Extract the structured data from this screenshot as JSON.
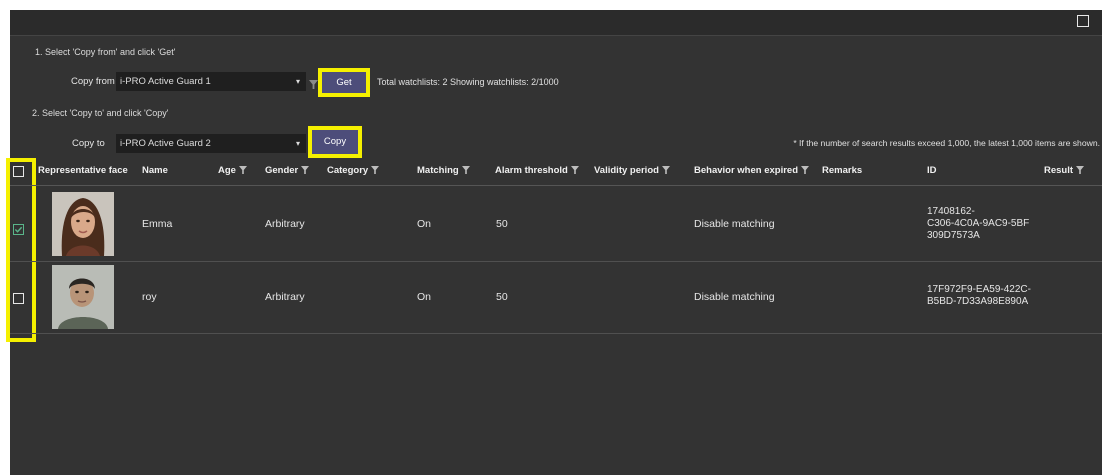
{
  "step1": "1. Select 'Copy from' and click 'Get'",
  "step2": "2. Select 'Copy to' and click 'Copy'",
  "copy_from": {
    "label": "Copy from",
    "value": "i-PRO Active Guard 1",
    "button": "Get"
  },
  "copy_to": {
    "label": "Copy to",
    "value": "i-PRO Active Guard 2",
    "button": "Copy"
  },
  "watchlist_info": "Total watchlists: 2 Showing watchlists: 2/1000",
  "note": "* If the number of search results exceed 1,000, the latest 1,000 items are shown.",
  "columns": {
    "face": "Representative face",
    "name": "Name",
    "age": "Age",
    "gender": "Gender",
    "category": "Category",
    "matching": "Matching",
    "alarm": "Alarm threshold",
    "validity": "Validity period",
    "behavior": "Behavior when expired",
    "remarks": "Remarks",
    "id": "ID",
    "result": "Result"
  },
  "rows": [
    {
      "checked": true,
      "name": "Emma",
      "gender": "Arbitrary",
      "matching": "On",
      "alarm": "50",
      "behavior": "Disable matching",
      "id_line1": "17408162-",
      "id_line2": "C306-4C0A-9AC9-5BF",
      "id_line3": "309D7573A"
    },
    {
      "checked": false,
      "name": "roy",
      "gender": "Arbitrary",
      "matching": "On",
      "alarm": "50",
      "behavior": "Disable matching",
      "id_line1": "17F972F9-EA59-422C-",
      "id_line2": "B5BD-7D33A98E890A",
      "id_line3": ""
    }
  ],
  "colors": {
    "highlight": "#f5f000",
    "button": "#4d4d7a",
    "panel": "#333333",
    "check": "#5ab58a"
  }
}
